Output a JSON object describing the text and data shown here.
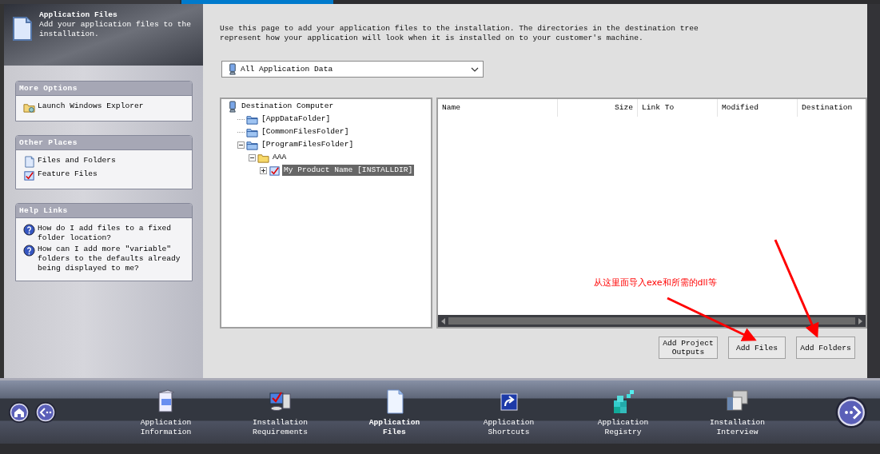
{
  "document_tabs": [
    {
      "selected": false
    },
    {
      "selected": true
    }
  ],
  "header": {
    "title": "Application Files",
    "subtitle": "Add your application files to the installation."
  },
  "sidebar": [
    {
      "title": "More Options",
      "items": [
        {
          "label": "Launch Windows Explorer",
          "kind": "explorer"
        }
      ]
    },
    {
      "title": "Other Places",
      "items": [
        {
          "label": "Files and Folders",
          "kind": "file"
        },
        {
          "label": "Feature Files",
          "kind": "feature"
        }
      ]
    },
    {
      "title": "Help Links",
      "items": [
        {
          "label": "How do I add files to a fixed folder location?",
          "kind": "help"
        },
        {
          "label": "How can I add more \"variable\" folders to the defaults already being displayed to me?",
          "kind": "help"
        }
      ]
    }
  ],
  "description": "Use this page to add your application files to the installation. The directories in the destination tree represent how your application will look when it is installed on to your customer's machine.",
  "dropdown": {
    "value": "All Application Data"
  },
  "tree": [
    {
      "label": "Destination Computer",
      "kind": "computer",
      "selected": false,
      "children": [
        {
          "label": "[AppDataFolder]",
          "kind": "folder",
          "selected": false
        },
        {
          "label": "[CommonFilesFolder]",
          "kind": "folder",
          "selected": false
        },
        {
          "label": "[ProgramFilesFolder]",
          "kind": "folder",
          "expanded": true,
          "selected": false,
          "children": [
            {
              "label": "AAA",
              "kind": "yellow-folder",
              "expanded": true,
              "selected": false,
              "children": [
                {
                  "label": "My Product Name [INSTALLDIR]",
                  "kind": "feature",
                  "expanded": false,
                  "selected": true
                }
              ]
            }
          ]
        }
      ]
    }
  ],
  "table": {
    "columns": [
      {
        "label": "Name"
      },
      {
        "label": "Size"
      },
      {
        "label": "Link To"
      },
      {
        "label": "Modified"
      },
      {
        "label": "Destination"
      }
    ]
  },
  "annotation": {
    "text": "从这里面导入exe和所需的dll等"
  },
  "buttons": [
    "Add Project Outputs",
    "Add Files",
    "Add Folders"
  ],
  "nav": [
    {
      "label": "Application Information",
      "kind": "info",
      "selected": false
    },
    {
      "label": "Installation Requirements",
      "kind": "requirements",
      "selected": false
    },
    {
      "label": "Application Files",
      "kind": "files",
      "selected": true
    },
    {
      "label": "Application Shortcuts",
      "kind": "shortcut",
      "selected": false
    },
    {
      "label": "Application Registry",
      "kind": "registry",
      "selected": false
    },
    {
      "label": "Installation Interview",
      "kind": "interview",
      "selected": false
    }
  ]
}
